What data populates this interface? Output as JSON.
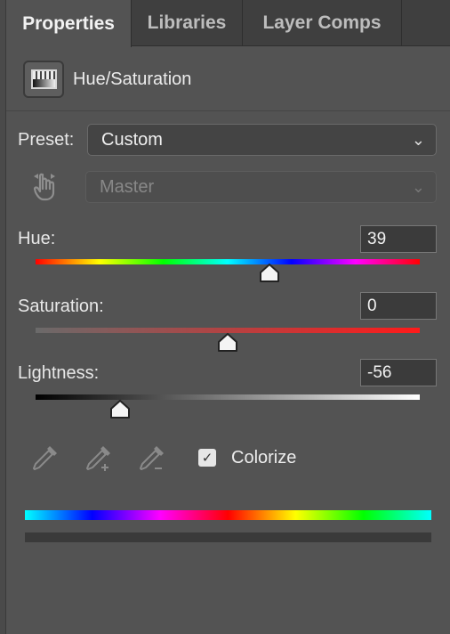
{
  "tabs": [
    {
      "label": "Properties",
      "active": true
    },
    {
      "label": "Libraries",
      "active": false
    },
    {
      "label": "Layer Comps",
      "active": false
    }
  ],
  "adjustment": {
    "title": "Hue/Saturation",
    "icon": "hue-saturation-adjustment-icon"
  },
  "preset": {
    "label": "Preset:",
    "value": "Custom"
  },
  "channel": {
    "value": "Master",
    "disabled": true,
    "icon": "targeted-adjustment-hand-icon"
  },
  "hue": {
    "label": "Hue:",
    "value": "39",
    "min": -180,
    "max": 180
  },
  "saturation": {
    "label": "Saturation:",
    "value": "0",
    "min": -100,
    "max": 100
  },
  "lightness": {
    "label": "Lightness:",
    "value": "-56",
    "min": -100,
    "max": 100
  },
  "tools": [
    "eyedropper-icon",
    "eyedropper-plus-icon",
    "eyedropper-minus-icon"
  ],
  "colorize": {
    "label": "Colorize",
    "checked": true
  },
  "colors": {
    "panel": "#535353",
    "tabbar": "#3f3f3f",
    "field": "#3b3b3b"
  }
}
